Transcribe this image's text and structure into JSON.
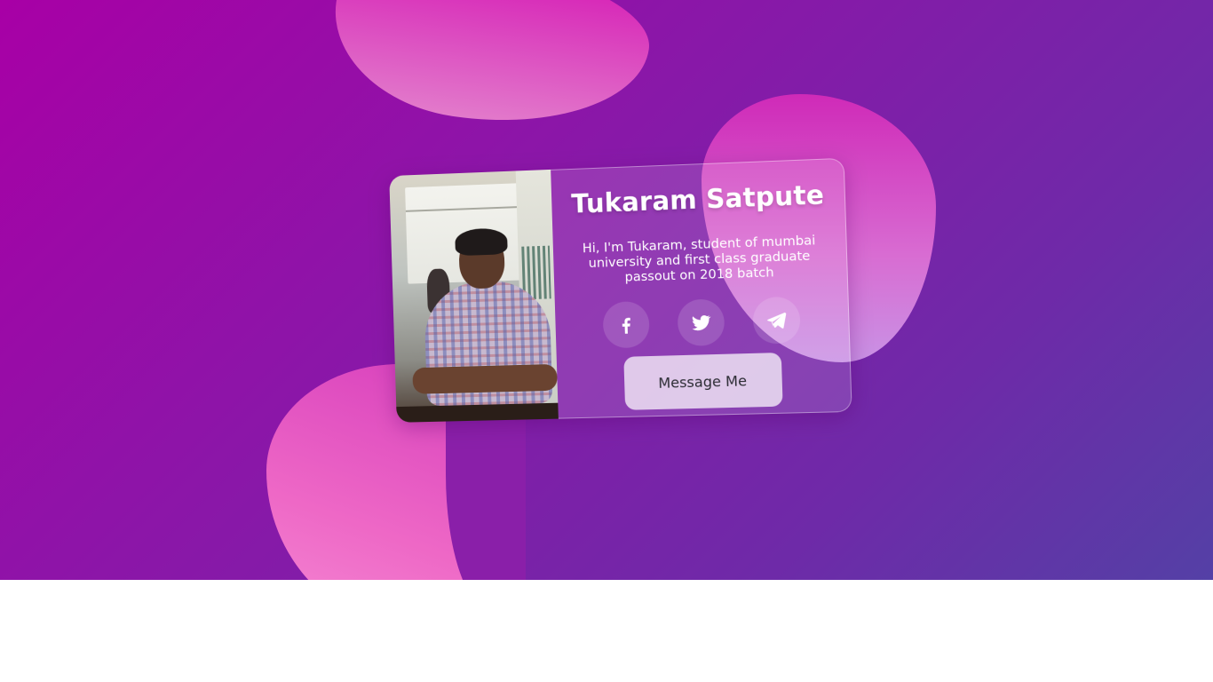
{
  "profile": {
    "name": "Tukaram Satpute",
    "bio": "Hi, I'm Tukaram, student of mumbai university and first class graduate passout on 2018 batch",
    "message_button_label": "Message Me"
  },
  "socials": [
    {
      "icon": "facebook-icon"
    },
    {
      "icon": "twitter-icon"
    },
    {
      "icon": "telegram-icon"
    }
  ],
  "theme": {
    "background_start": "#a800a6",
    "background_end": "#5440a6",
    "blob_pink": "#d61fb6",
    "button_bg": "#e7d7ea"
  }
}
